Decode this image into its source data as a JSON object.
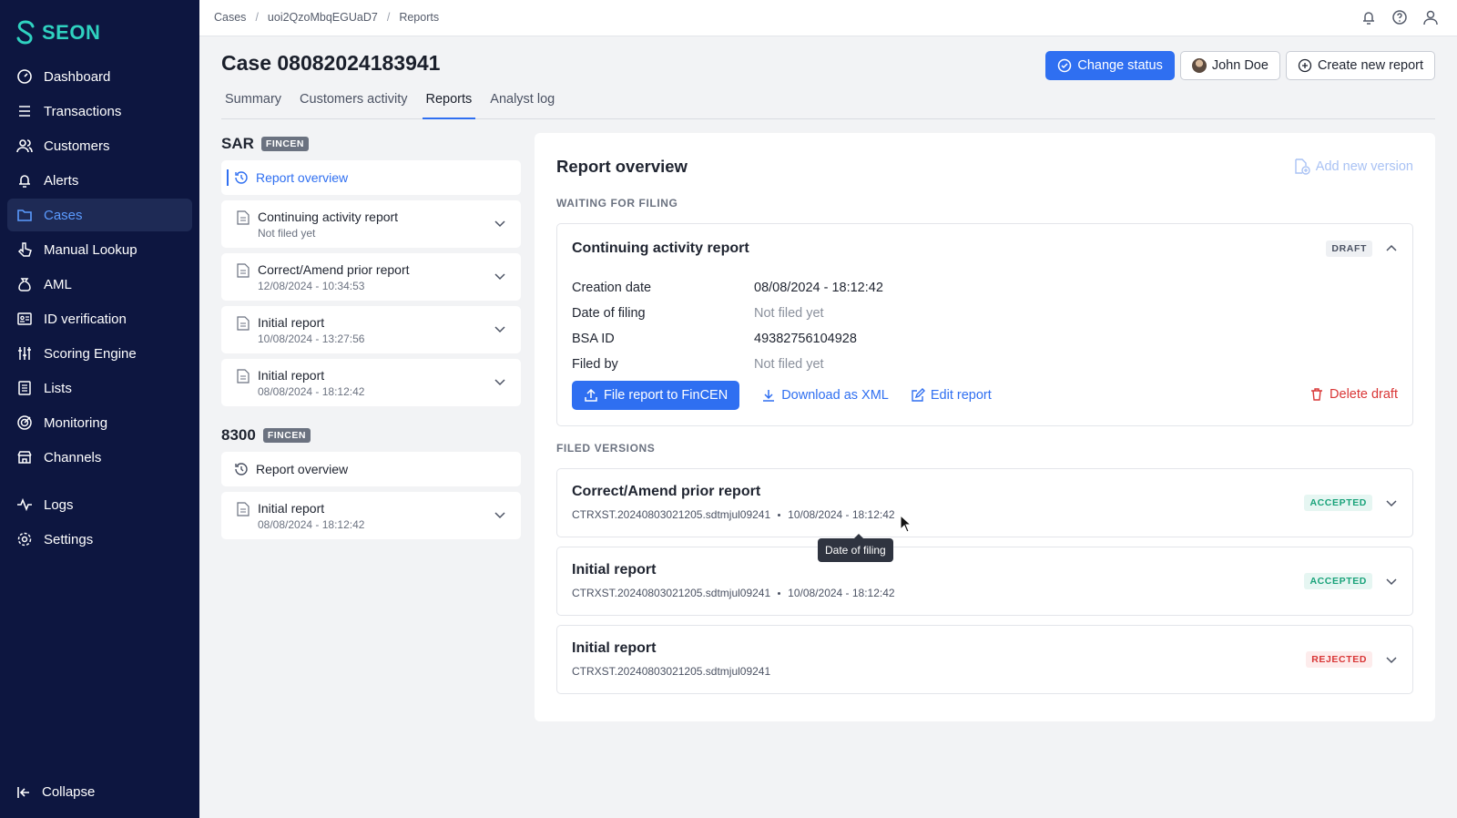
{
  "brand": {
    "name": "SEON",
    "accent": "#2fd2c0"
  },
  "sidebar": {
    "items": [
      {
        "label": "Dashboard",
        "icon": "dashboard-icon"
      },
      {
        "label": "Transactions",
        "icon": "list-icon"
      },
      {
        "label": "Customers",
        "icon": "users-icon"
      },
      {
        "label": "Alerts",
        "icon": "bell-icon"
      },
      {
        "label": "Cases",
        "icon": "folder-icon",
        "active": true
      },
      {
        "label": "Manual Lookup",
        "icon": "pointer-icon"
      },
      {
        "label": "AML",
        "icon": "aml-icon"
      },
      {
        "label": "ID verification",
        "icon": "id-card-icon"
      },
      {
        "label": "Scoring Engine",
        "icon": "sliders-icon"
      },
      {
        "label": "Lists",
        "icon": "lists-icon"
      },
      {
        "label": "Monitoring",
        "icon": "target-icon"
      },
      {
        "label": "Channels",
        "icon": "store-icon"
      }
    ],
    "items2": [
      {
        "label": "Logs",
        "icon": "pulse-icon"
      },
      {
        "label": "Settings",
        "icon": "gear-icon"
      }
    ],
    "collapse_label": "Collapse"
  },
  "breadcrumb": [
    "Cases",
    "uoi2QzoMbqEGUaD7",
    "Reports"
  ],
  "header": {
    "title": "Case 08082024183941",
    "change_status": "Change status",
    "assignee": "John Doe",
    "create_report": "Create new report"
  },
  "tabs": [
    "Summary",
    "Customers activity",
    "Reports",
    "Analyst log"
  ],
  "left": {
    "sar": {
      "title": "SAR",
      "badge": "FINCEN",
      "overview": "Report overview",
      "reports": [
        {
          "title": "Continuing activity report",
          "sub": "Not filed yet"
        },
        {
          "title": "Correct/Amend prior report",
          "sub": "12/08/2024 - 10:34:53"
        },
        {
          "title": "Initial report",
          "sub": "10/08/2024 - 13:27:56"
        },
        {
          "title": "Initial report",
          "sub": "08/08/2024 - 18:12:42"
        }
      ]
    },
    "f8300": {
      "title": "8300",
      "badge": "FINCEN",
      "overview": "Report overview",
      "reports": [
        {
          "title": "Initial report",
          "sub": "08/08/2024 - 18:12:42"
        }
      ]
    }
  },
  "overview": {
    "title": "Report overview",
    "add_version": "Add new version",
    "waiting_label": "WAITING FOR FILING",
    "draft": {
      "title": "Continuing activity report",
      "badge": "DRAFT",
      "fields": [
        {
          "k": "Creation date",
          "v": "08/08/2024 - 18:12:42"
        },
        {
          "k": "Date of filing",
          "v": "Not filed yet"
        },
        {
          "k": "BSA ID",
          "v": "49382756104928"
        },
        {
          "k": "Filed by",
          "v": "Not filed yet"
        }
      ],
      "file_btn": "File report to FinCEN",
      "download": "Download as XML",
      "edit": "Edit report",
      "delete": "Delete draft"
    },
    "filed_label": "FILED VERSIONS",
    "versions": [
      {
        "title": "Correct/Amend prior report",
        "file": "CTRXST.20240803021205.sdtmjul09241",
        "date": "10/08/2024 - 18:12:42",
        "status": "ACCEPTED"
      },
      {
        "title": "Initial report",
        "file": "CTRXST.20240803021205.sdtmjul09241",
        "date": "10/08/2024 - 18:12:42",
        "status": "ACCEPTED"
      },
      {
        "title": "Initial report",
        "file": "CTRXST.20240803021205.sdtmjul09241",
        "date": "",
        "status": "REJECTED"
      }
    ],
    "tooltip": "Date of filing"
  }
}
